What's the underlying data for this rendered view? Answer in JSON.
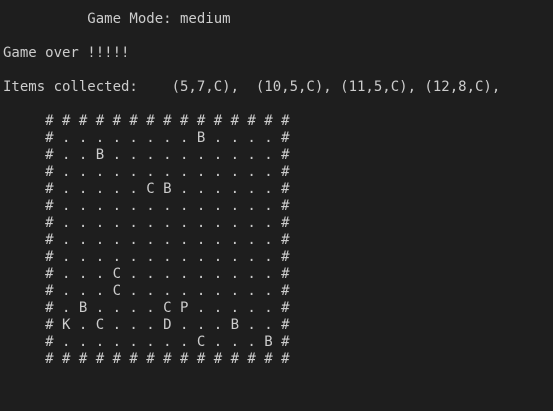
{
  "terminal": {
    "background": "#1e1e1e",
    "text_color": "#cccccc",
    "mode_line": "          Game Mode: medium",
    "game_over": "Game over !!!!!",
    "items_line": "Items collected:    (5,7,C),  (10,5,C), (11,5,C), (12,8,C),",
    "board": [
      "     # # # # # # # # # # # # # # #",
      "     # . . . . . . . . B . . . . #",
      "     # . . B . . . . . . . . . . #",
      "     # . . . . . . . . . . . . . #",
      "     # . . . . . C B . . . . . . #",
      "     # . . . . . . . . . . . . . #",
      "     # . . . . . . . . . . . . . #",
      "     # . . . . . . . . . . . . . #",
      "     # . . . . . . . . . . . . . #",
      "     # . . . C . . . . . . . . . #",
      "     # . . . C . . . . . . . . . #",
      "     # . B . . . . C P . . . . . #",
      "     # K . C . . . D . . . B . . #",
      "     # . . . . . . . . C . . . B #",
      "     # # # # # # # # # # # # # # #"
    ]
  }
}
